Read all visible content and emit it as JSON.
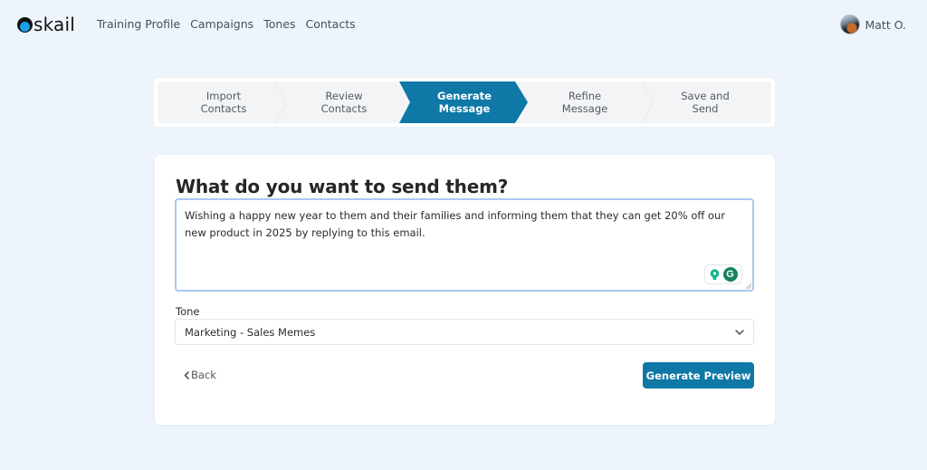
{
  "brand": {
    "name": "skail",
    "accent": "#1a9fe6"
  },
  "nav": {
    "links": [
      {
        "label": "Training Profile"
      },
      {
        "label": "Campaigns"
      },
      {
        "label": "Tones"
      },
      {
        "label": "Contacts"
      }
    ]
  },
  "user": {
    "name": "Matt O.",
    "avatar_icon": "user-avatar"
  },
  "stepper": {
    "active_index": 2,
    "active_color": "#0f78a6",
    "steps": [
      {
        "line1": "Import",
        "line2": "Contacts"
      },
      {
        "line1": "Review",
        "line2": "Contacts"
      },
      {
        "line1": "Generate",
        "line2": "Message"
      },
      {
        "line1": "Refine",
        "line2": "Message"
      },
      {
        "line1": "Save and",
        "line2": "Send"
      }
    ]
  },
  "form": {
    "title": "What do you want to send them?",
    "message_value": "Wishing a happy new year to them and their families and informing them that they can get 20% off our new product in 2025 by replying to this email.",
    "grammarly_label": "G",
    "tone_label": "Tone",
    "tone_selected": "Marketing - Sales Memes",
    "back_label": "Back",
    "generate_label": "Generate Preview"
  }
}
